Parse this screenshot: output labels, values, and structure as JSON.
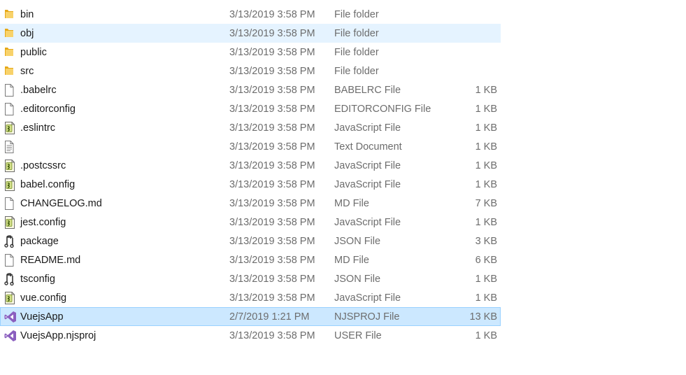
{
  "files": [
    {
      "name": "bin",
      "date": "3/13/2019 3:58 PM",
      "type": "File folder",
      "size": "",
      "icon": "folder-icon",
      "state": ""
    },
    {
      "name": "obj",
      "date": "3/13/2019 3:58 PM",
      "type": "File folder",
      "size": "",
      "icon": "folder-icon",
      "state": "hover"
    },
    {
      "name": "public",
      "date": "3/13/2019 3:58 PM",
      "type": "File folder",
      "size": "",
      "icon": "folder-icon",
      "state": ""
    },
    {
      "name": "src",
      "date": "3/13/2019 3:58 PM",
      "type": "File folder",
      "size": "",
      "icon": "folder-icon",
      "state": ""
    },
    {
      "name": ".babelrc",
      "date": "3/13/2019 3:58 PM",
      "type": "BABELRC File",
      "size": "1 KB",
      "icon": "blank-file-icon",
      "state": ""
    },
    {
      "name": ".editorconfig",
      "date": "3/13/2019 3:58 PM",
      "type": "EDITORCONFIG File",
      "size": "1 KB",
      "icon": "blank-file-icon",
      "state": ""
    },
    {
      "name": ".eslintrc",
      "date": "3/13/2019 3:58 PM",
      "type": "JavaScript File",
      "size": "1 KB",
      "icon": "javascript-file-icon",
      "state": ""
    },
    {
      "name": "",
      "date": "3/13/2019 3:58 PM",
      "type": "Text Document",
      "size": "1 KB",
      "icon": "text-file-icon",
      "state": ""
    },
    {
      "name": ".postcssrc",
      "date": "3/13/2019 3:58 PM",
      "type": "JavaScript File",
      "size": "1 KB",
      "icon": "javascript-file-icon",
      "state": ""
    },
    {
      "name": "babel.config",
      "date": "3/13/2019 3:58 PM",
      "type": "JavaScript File",
      "size": "1 KB",
      "icon": "javascript-file-icon",
      "state": ""
    },
    {
      "name": "CHANGELOG.md",
      "date": "3/13/2019 3:58 PM",
      "type": "MD File",
      "size": "7 KB",
      "icon": "blank-file-icon",
      "state": ""
    },
    {
      "name": "jest.config",
      "date": "3/13/2019 3:58 PM",
      "type": "JavaScript File",
      "size": "1 KB",
      "icon": "javascript-file-icon",
      "state": ""
    },
    {
      "name": "package",
      "date": "3/13/2019 3:58 PM",
      "type": "JSON File",
      "size": "3 KB",
      "icon": "json-file-icon",
      "state": ""
    },
    {
      "name": "README.md",
      "date": "3/13/2019 3:58 PM",
      "type": "MD File",
      "size": "6 KB",
      "icon": "blank-file-icon",
      "state": ""
    },
    {
      "name": "tsconfig",
      "date": "3/13/2019 3:58 PM",
      "type": "JSON File",
      "size": "1 KB",
      "icon": "json-file-icon",
      "state": ""
    },
    {
      "name": "vue.config",
      "date": "3/13/2019 3:58 PM",
      "type": "JavaScript File",
      "size": "1 KB",
      "icon": "javascript-file-icon",
      "state": ""
    },
    {
      "name": "VuejsApp",
      "date": "2/7/2019 1:21 PM",
      "type": "NJSPROJ File",
      "size": "13 KB",
      "icon": "visual-studio-icon",
      "state": "selected"
    },
    {
      "name": "VuejsApp.njsproj",
      "date": "3/13/2019 3:58 PM",
      "type": "USER File",
      "size": "1 KB",
      "icon": "visual-studio-icon",
      "state": ""
    }
  ],
  "colors": {
    "hover_background": "#e5f3ff",
    "selected_background": "#cce8ff",
    "selected_border": "#99d1ff",
    "folder": "#f5c24a",
    "visual_studio": "#8b5fbf"
  }
}
